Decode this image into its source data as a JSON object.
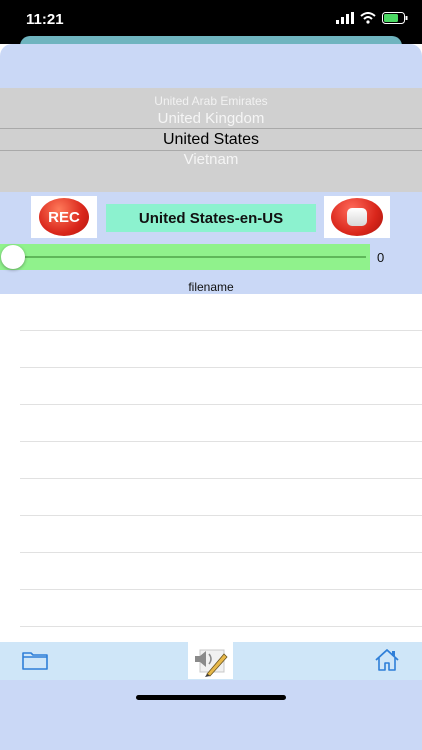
{
  "status": {
    "time": "11:21"
  },
  "picker": {
    "items": [
      {
        "label": "United Arab Emirates",
        "state": "far"
      },
      {
        "label": "United Kingdom",
        "state": "near"
      },
      {
        "label": "United States",
        "state": "selected"
      },
      {
        "label": "Vietnam",
        "state": "near"
      }
    ]
  },
  "controls": {
    "rec_label": "REC",
    "language_label": "United States-en-US",
    "stop_icon": "stop-icon"
  },
  "slider": {
    "value_text": "0",
    "fraction": 0
  },
  "table": {
    "header": "filename",
    "row_count": 9
  },
  "toolbar": {
    "folder_icon": "folder-icon",
    "edit_icon": "speaker-pencil-icon",
    "home_icon": "home-icon"
  },
  "colors": {
    "sheet": "#cad8f6",
    "picker": "#d0d0d0",
    "language_bg": "#8cf2cf",
    "slider_bg": "#90f28c",
    "toolbar": "#cfe6f8",
    "icon_blue": "#2f7fd8"
  }
}
